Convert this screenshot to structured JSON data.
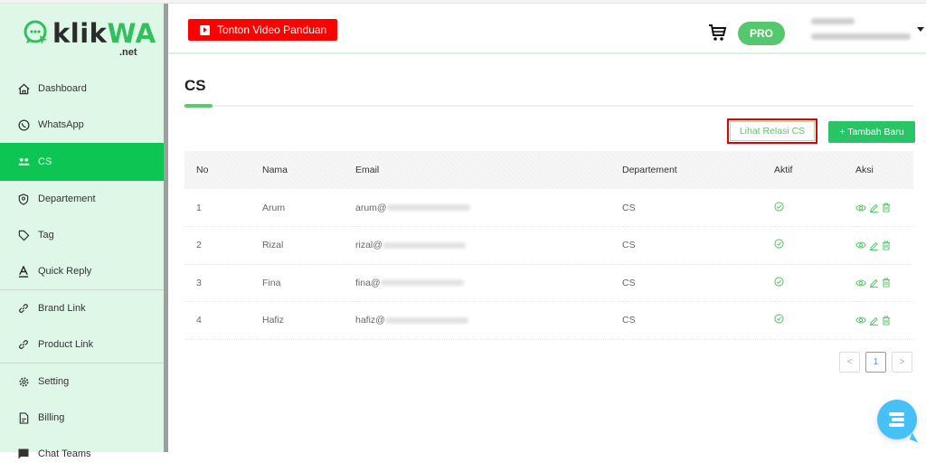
{
  "brand": {
    "name_dark": "klik",
    "name_green": "WA",
    "suffix": ".net"
  },
  "sidebar": {
    "items": [
      {
        "label": "Dashboard",
        "icon": "home-icon"
      },
      {
        "label": "WhatsApp",
        "icon": "whatsapp-icon"
      },
      {
        "label": "CS",
        "icon": "users-icon",
        "active": true
      },
      {
        "label": "Departement",
        "icon": "badge-icon"
      },
      {
        "label": "Tag",
        "icon": "tag-icon"
      },
      {
        "label": "Quick Reply",
        "icon": "font-icon"
      },
      {
        "label": "Brand Link",
        "icon": "link-icon"
      },
      {
        "label": "Product Link",
        "icon": "link-icon"
      },
      {
        "label": "Setting",
        "icon": "gear-icon"
      },
      {
        "label": "Billing",
        "icon": "document-icon"
      },
      {
        "label": "Chat Teams",
        "icon": "chat-icon"
      }
    ]
  },
  "header": {
    "video_button": "Tonton Video Panduan",
    "plan_badge": "PRO"
  },
  "page": {
    "title": "CS",
    "relasi_button": "Lihat Relasi CS",
    "add_button": "+ Tambah Baru"
  },
  "table": {
    "columns": [
      "No",
      "Nama",
      "Email",
      "Departement",
      "Aktif",
      "Aksi"
    ],
    "rows": [
      {
        "no": "1",
        "nama": "Arum",
        "email": "arum@",
        "dept": "CS",
        "aktif": true
      },
      {
        "no": "2",
        "nama": "Rizal",
        "email": "rizal@",
        "dept": "CS",
        "aktif": true
      },
      {
        "no": "3",
        "nama": "Fina",
        "email": "fina@",
        "dept": "CS",
        "aktif": true
      },
      {
        "no": "4",
        "nama": "Hafiz",
        "email": "hafiz@",
        "dept": "CS",
        "aktif": true
      }
    ]
  },
  "pagination": {
    "prev": "<",
    "current": "1",
    "next": ">"
  },
  "colors": {
    "accent": "#0dc552",
    "video": "#ff0000",
    "sidebar_bg": "#dff7e7",
    "chat_fab": "#46c1f5"
  }
}
